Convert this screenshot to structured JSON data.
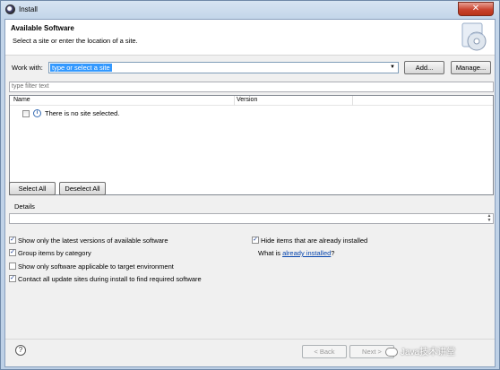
{
  "window": {
    "title": "Install",
    "close_glyph": "✕"
  },
  "banner": {
    "title": "Available Software",
    "description": "Select a site or enter the location of a site."
  },
  "work_with": {
    "label": "Work with:",
    "value": "type or select a site",
    "add_label": "Add...",
    "manage_label": "Manage..."
  },
  "filter": {
    "placeholder": "type filter text"
  },
  "table": {
    "columns": [
      "Name",
      "Version"
    ],
    "rows": [
      {
        "name": "There is no site selected.",
        "checked": false,
        "icon": "info-icon"
      }
    ]
  },
  "selection_buttons": {
    "select_all": "Select All",
    "deselect_all": "Deselect All"
  },
  "details": {
    "label": "Details"
  },
  "options": {
    "show_latest": {
      "label": "Show only the latest versions of available software",
      "checked": true
    },
    "group_by_category": {
      "label": "Group items by category",
      "checked": true
    },
    "target_env": {
      "label": "Show only software applicable to target environment",
      "checked": false
    },
    "contact_all": {
      "label": "Contact all update sites during install to find required software",
      "checked": true
    },
    "hide_installed": {
      "label": "Hide items that are already installed",
      "checked": true
    },
    "what_is_prefix": "What is ",
    "what_is_link": "already installed",
    "what_is_suffix": "?"
  },
  "footer": {
    "help_glyph": "?",
    "back_label": "< Back",
    "next_label": "Next >",
    "watermark": "Java技术讲堂"
  }
}
